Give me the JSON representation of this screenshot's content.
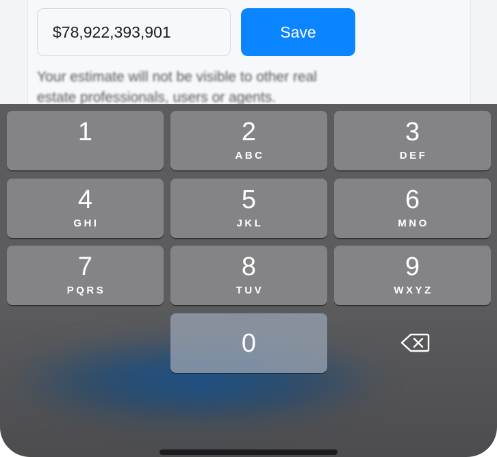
{
  "form": {
    "estimate_value": "$78,922,393,901",
    "save_label": "Save",
    "notice_text": "Your estimate will not be visible to other real estate professionals, users or agents."
  },
  "keyboard": {
    "keys": [
      {
        "digit": "1",
        "letters": ""
      },
      {
        "digit": "2",
        "letters": "ABC"
      },
      {
        "digit": "3",
        "letters": "DEF"
      },
      {
        "digit": "4",
        "letters": "GHI"
      },
      {
        "digit": "5",
        "letters": "JKL"
      },
      {
        "digit": "6",
        "letters": "MNO"
      },
      {
        "digit": "7",
        "letters": "PQRS"
      },
      {
        "digit": "8",
        "letters": "TUV"
      },
      {
        "digit": "9",
        "letters": "WXYZ"
      },
      {
        "digit": "0",
        "letters": ""
      }
    ],
    "delete_icon": "delete-backspace-icon"
  },
  "colors": {
    "accent": "#0a84ff",
    "keyboard_bg": "#5c5c5e",
    "key_bg": "#848486"
  }
}
